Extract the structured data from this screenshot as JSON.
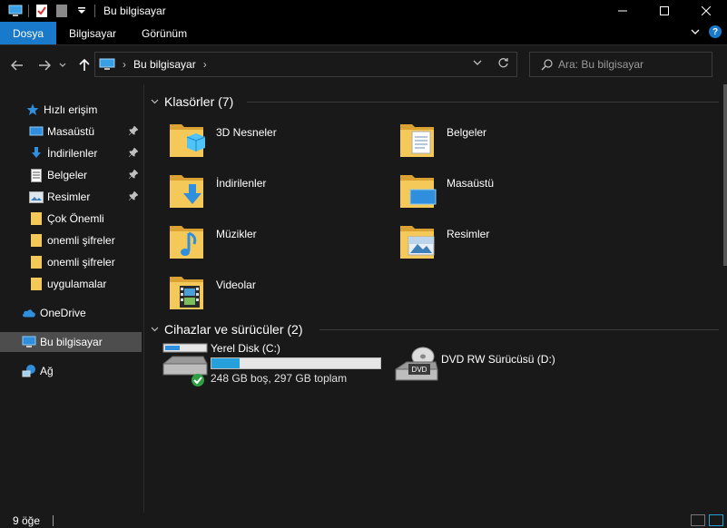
{
  "window": {
    "title": "Bu bilgisayar"
  },
  "ribbon": {
    "tabs": [
      {
        "label": "Dosya",
        "active": true
      },
      {
        "label": "Bilgisayar",
        "active": false
      },
      {
        "label": "Görünüm",
        "active": false
      }
    ],
    "help_label": "?"
  },
  "address": {
    "path": "Bu bilgisayar",
    "search_placeholder": "Ara: Bu bilgisayar"
  },
  "sidebar": {
    "items": [
      {
        "label": "Hızlı erişim",
        "icon": "star-icon",
        "pinned": false
      },
      {
        "label": "Masaüstü",
        "icon": "desktop-icon",
        "pinned": true
      },
      {
        "label": "İndirilenler",
        "icon": "download-icon",
        "pinned": true
      },
      {
        "label": "Belgeler",
        "icon": "documents-icon",
        "pinned": true
      },
      {
        "label": "Resimler",
        "icon": "pictures-icon",
        "pinned": true
      },
      {
        "label": "Çok Önemli",
        "icon": "folder-icon",
        "pinned": false
      },
      {
        "label": "onemli şifreler",
        "icon": "folder-icon",
        "pinned": false
      },
      {
        "label": "onemli şifreler",
        "icon": "folder-icon",
        "pinned": false
      },
      {
        "label": "uygulamalar",
        "icon": "folder-icon",
        "pinned": false
      },
      {
        "label": "OneDrive",
        "icon": "onedrive-icon",
        "pinned": false
      },
      {
        "label": "Bu bilgisayar",
        "icon": "computer-icon",
        "pinned": false,
        "selected": true
      },
      {
        "label": "Ağ",
        "icon": "network-icon",
        "pinned": false
      }
    ]
  },
  "main": {
    "folders_header": "Klasörler (7)",
    "folders": [
      {
        "label": "3D Nesneler",
        "icon": "3d-objects-icon"
      },
      {
        "label": "Belgeler",
        "icon": "documents-icon"
      },
      {
        "label": "İndirilenler",
        "icon": "download-icon"
      },
      {
        "label": "Masaüstü",
        "icon": "desktop-icon"
      },
      {
        "label": "Müzikler",
        "icon": "music-icon"
      },
      {
        "label": "Resimler",
        "icon": "pictures-icon"
      },
      {
        "label": "Videolar",
        "icon": "videos-icon"
      }
    ],
    "devices_header": "Cihazlar ve sürücüler (2)",
    "devices": [
      {
        "label": "Yerel Disk (C:)",
        "free_text": "248 GB boş, 297 GB toplam",
        "used_fraction": 0.165,
        "icon": "hard-drive-icon"
      },
      {
        "label": "DVD RW Sürücüsü (D:)",
        "icon": "dvd-drive-icon",
        "badge": "DVD"
      }
    ]
  },
  "status": {
    "item_count": "9 öğe"
  },
  "colors": {
    "accent": "#1979ca",
    "bar_fill": "#26a0da",
    "background": "#191919",
    "folder": "#f5c85a"
  }
}
